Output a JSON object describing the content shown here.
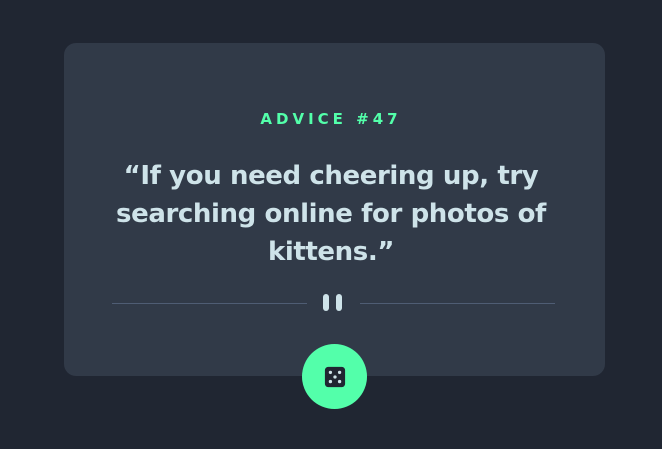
{
  "advice": {
    "id_label": "ADVICE #47",
    "quote": "“If you need cheering up, try searching online for photos of kittens.”"
  },
  "icons": {
    "divider": "pause-icon",
    "button": "dice-icon"
  },
  "colors": {
    "page_background": "#202632",
    "card_background": "#313a48",
    "accent": "#53ffaa",
    "quote_text": "#cee3e9",
    "divider": "#4f5d74"
  }
}
